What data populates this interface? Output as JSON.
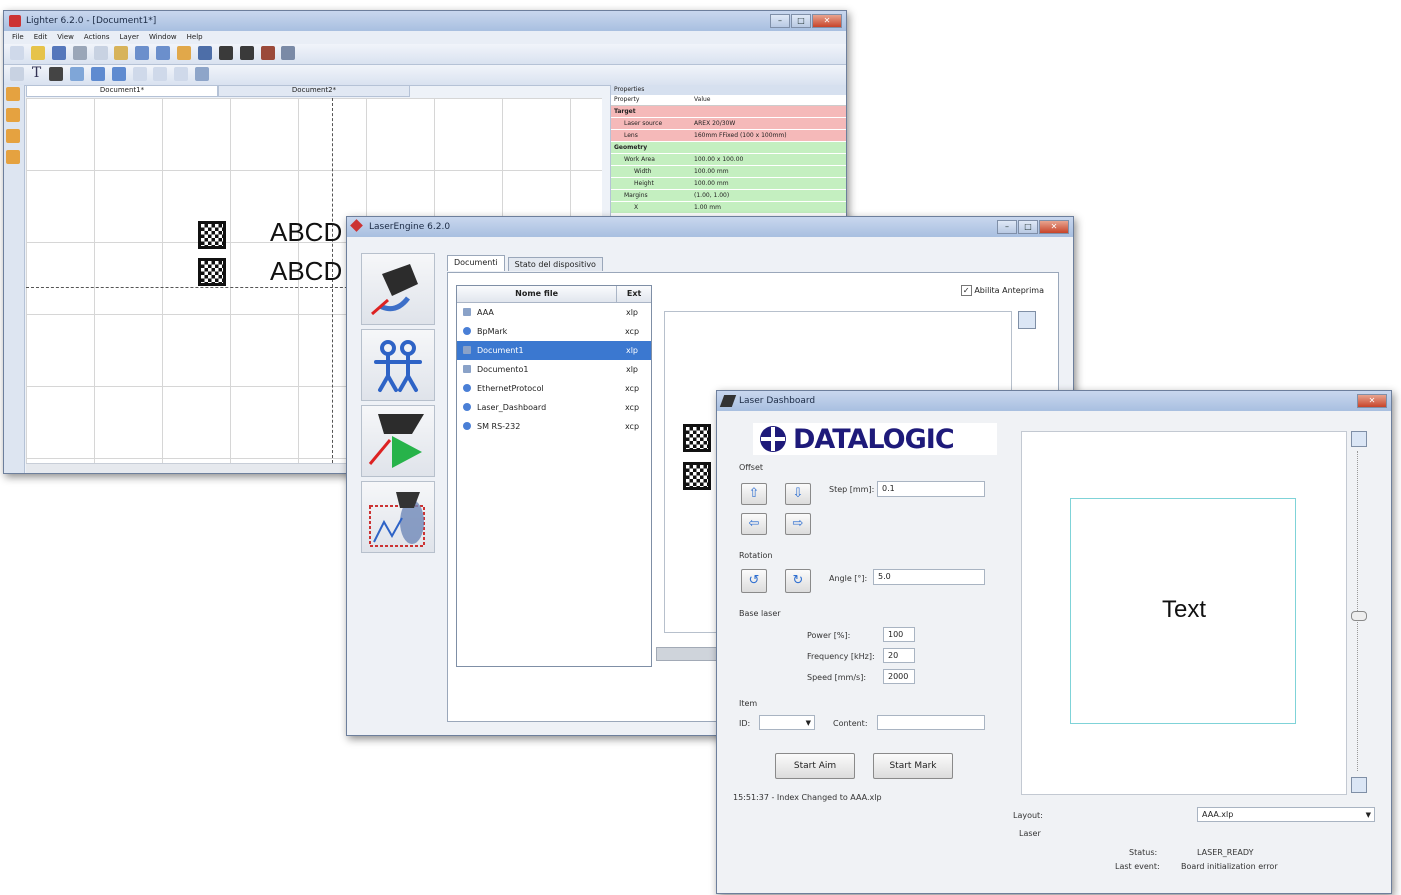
{
  "editor": {
    "title": "Lighter 6.2.0 - [Document1*]",
    "menu": [
      "File",
      "Edit",
      "View",
      "Actions",
      "Layer",
      "Window",
      "Help"
    ],
    "tabs": [
      "Document1*",
      "Document2*"
    ],
    "canvas_text": [
      "ABCD",
      "ABCD"
    ],
    "properties": {
      "title": "Properties",
      "col_property": "Property",
      "col_value": "Value",
      "rows": [
        {
          "name": "Target",
          "value": "",
          "group": "red",
          "level": 0
        },
        {
          "name": "Laser source",
          "value": "AREX 20/30W",
          "group": "red",
          "level": 1
        },
        {
          "name": "Lens",
          "value": "160mm FFixed (100 x 100mm)",
          "group": "red",
          "level": 1
        },
        {
          "name": "Geometry",
          "value": "",
          "group": "green",
          "level": 0
        },
        {
          "name": "Work Area",
          "value": "100.00 x 100.00",
          "group": "green",
          "level": 1
        },
        {
          "name": "Width",
          "value": "100.00 mm",
          "group": "green",
          "level": 2
        },
        {
          "name": "Height",
          "value": "100.00 mm",
          "group": "green",
          "level": 2
        },
        {
          "name": "Margins",
          "value": "(1.00, 1.00)",
          "group": "green",
          "level": 1
        },
        {
          "name": "X",
          "value": "1.00 mm",
          "group": "green",
          "level": 2
        }
      ]
    }
  },
  "engine": {
    "title": "LaserEngine 6.2.0",
    "tabs": [
      "Documenti",
      "Stato del dispositivo"
    ],
    "preview_checkbox": "Abilita Anteprima",
    "col_name": "Nome file",
    "col_ext": "Ext",
    "files": [
      {
        "name": "AAA",
        "ext": "xlp",
        "icon": "xlp"
      },
      {
        "name": "BpMark",
        "ext": "xcp",
        "icon": "xcp"
      },
      {
        "name": "Document1",
        "ext": "xlp",
        "icon": "xlp",
        "selected": true
      },
      {
        "name": "Documento1",
        "ext": "xlp",
        "icon": "xlp"
      },
      {
        "name": "EthernetProtocol",
        "ext": "xcp",
        "icon": "xcp"
      },
      {
        "name": "Laser_Dashboard",
        "ext": "xcp",
        "icon": "xcp"
      },
      {
        "name": "SM RS-232",
        "ext": "xcp",
        "icon": "xcp"
      }
    ]
  },
  "dashboard": {
    "title": "Laser Dashboard",
    "brand": "DATALOGIC",
    "offset_label": "Offset",
    "step_label": "Step [mm]:",
    "step_value": "0.1",
    "rotation_label": "Rotation",
    "angle_label": "Angle [°]:",
    "angle_value": "5.0",
    "base_laser_label": "Base laser",
    "power_label": "Power [%]:",
    "power_value": "100",
    "frequency_label": "Frequency [kHz]:",
    "frequency_value": "20",
    "speed_label": "Speed [mm/s]:",
    "speed_value": "2000",
    "item_label": "Item",
    "id_label": "ID:",
    "content_label": "Content:",
    "start_aim": "Start Aim",
    "start_mark": "Start Mark",
    "log_message": "15:51:37 - Index Changed to AAA.xlp",
    "preview_text": "Text",
    "layout_label": "Layout:",
    "layout_value": "AAA.xlp",
    "laser_label": "Laser",
    "status_label": "Status:",
    "status_value": "LASER_READY",
    "last_event_label": "Last event:",
    "last_event_value": "Board initialization error"
  },
  "colors": {
    "titlebar": "#b9cbe6",
    "selection": "#3b78d0",
    "brand_blue": "#1e1a7a",
    "preview_border": "#7fd3d8",
    "prop_red": "#f5b9b9",
    "prop_green": "#c4efc0"
  }
}
